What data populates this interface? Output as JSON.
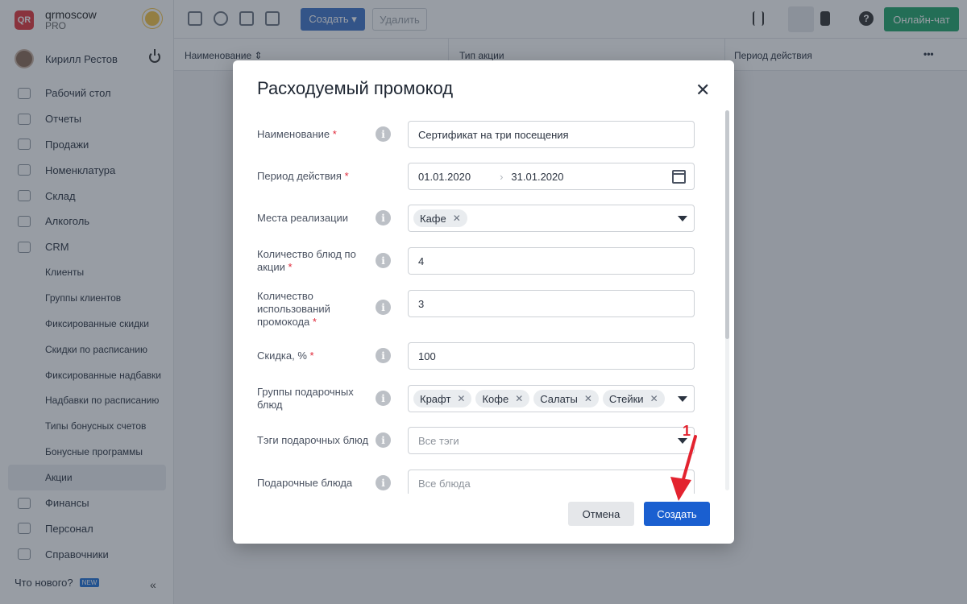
{
  "app": {
    "name": "qrmoscow",
    "plan": "PRO",
    "logo_text": "QR"
  },
  "user": {
    "name": "Кирилл Рестов"
  },
  "sidebar": {
    "items": [
      {
        "label": "Рабочий стол",
        "icon": "gauge-icon"
      },
      {
        "label": "Отчеты",
        "icon": "chart-icon"
      },
      {
        "label": "Продажи",
        "icon": "basket-icon"
      },
      {
        "label": "Номенклатура",
        "icon": "tag-icon"
      },
      {
        "label": "Склад",
        "icon": "box-icon"
      },
      {
        "label": "Алкоголь",
        "icon": "glass-icon"
      },
      {
        "label": "CRM",
        "icon": "people-icon"
      },
      {
        "label": "Клиенты"
      },
      {
        "label": "Группы клиентов"
      },
      {
        "label": "Фиксированные скидки"
      },
      {
        "label": "Скидки по расписанию"
      },
      {
        "label": "Фиксированные надбавки"
      },
      {
        "label": "Надбавки по расписанию"
      },
      {
        "label": "Типы бонусных счетов"
      },
      {
        "label": "Бонусные программы"
      },
      {
        "label": "Акции"
      },
      {
        "label": "Финансы",
        "icon": "wallet-icon"
      },
      {
        "label": "Персонал",
        "icon": "person-icon"
      },
      {
        "label": "Справочники",
        "icon": "book-icon"
      }
    ],
    "whats_new": "Что нового?",
    "new_badge": "NEW",
    "collapse_icon": "«"
  },
  "toolbar": {
    "create_label": "Создать ▾",
    "delete_label": "Удалить",
    "chat_label": "Онлайн-чат",
    "help_icon": "?"
  },
  "table": {
    "columns": [
      "Наименование ⇕",
      "Тип акции",
      "Период действия"
    ],
    "more_icon": "•••"
  },
  "modal": {
    "title": "Расходуемый промокод",
    "close_icon": "✕",
    "info_icon": "i",
    "required_mark": "*",
    "fields": {
      "name": {
        "label": "Наименование",
        "value": "Сертификат на три посещения"
      },
      "period": {
        "label": "Период действия",
        "from": "01.01.2020",
        "sep": "›",
        "to": "31.01.2020"
      },
      "places": {
        "label": "Места реализации",
        "tags": [
          "Кафе"
        ]
      },
      "dish_count": {
        "label": "Количество блюд по акции",
        "value": "4"
      },
      "usage_count": {
        "label": "Количество использований промокода",
        "value": "3"
      },
      "discount": {
        "label": "Скидка, %",
        "value": "100"
      },
      "gift_groups": {
        "label": "Группы подарочных блюд",
        "tags": [
          "Крафт",
          "Кофе",
          "Салаты",
          "Стейки"
        ]
      },
      "gift_tags": {
        "label": "Тэги подарочных блюд",
        "placeholder": "Все тэги"
      },
      "gift_dishes": {
        "label": "Подарочные блюда",
        "placeholder": "Все блюда"
      }
    },
    "cancel_label": "Отмена",
    "submit_label": "Создать"
  },
  "annotation": {
    "step": "1",
    "color": "#e3232f"
  },
  "colors": {
    "primary": "#1a5fd0",
    "chat": "#20a56a",
    "required": "#e0293a"
  }
}
